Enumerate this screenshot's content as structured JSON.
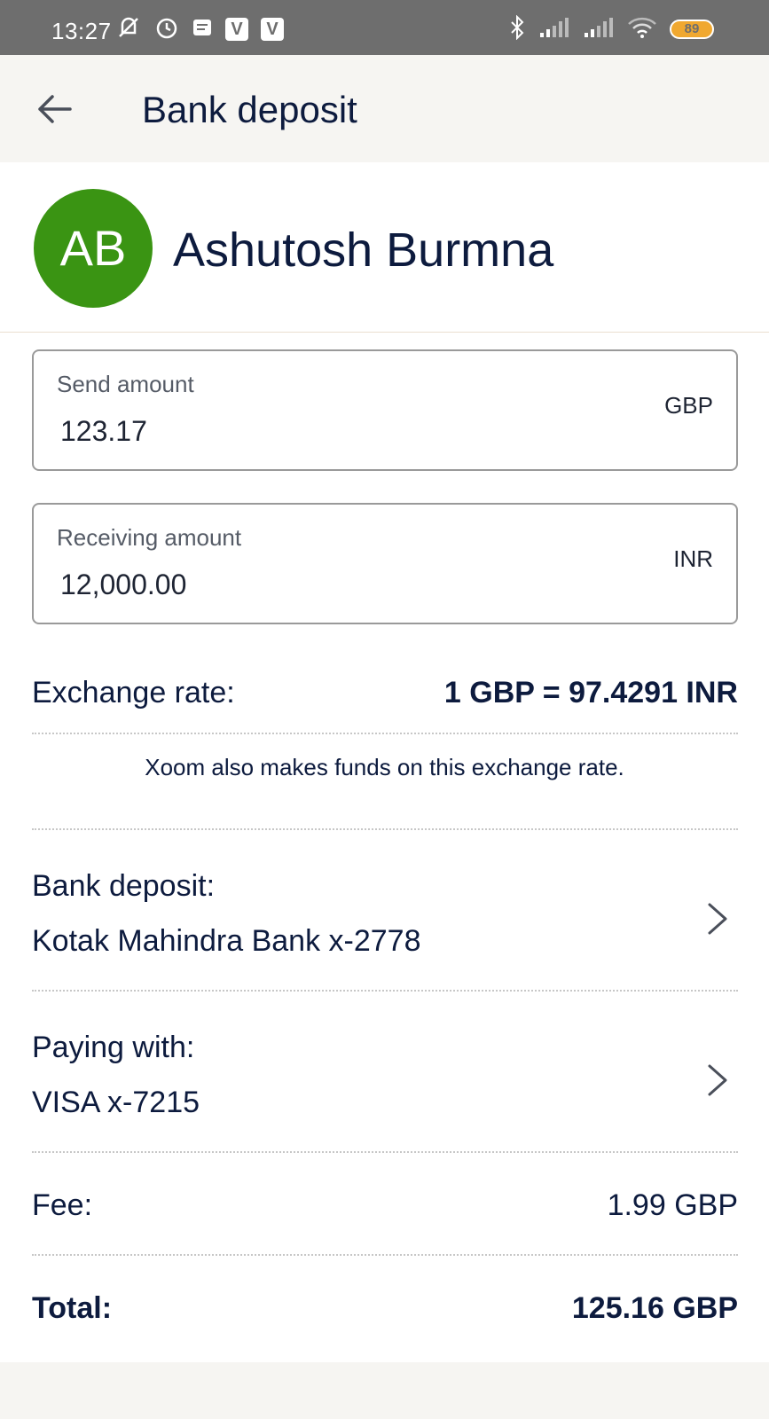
{
  "status_bar": {
    "time": "13:27",
    "battery": "89"
  },
  "header": {
    "title": "Bank deposit"
  },
  "recipient": {
    "initials": "AB",
    "name": "Ashutosh Burmna",
    "avatar_color": "#3a9413"
  },
  "send": {
    "label": "Send amount",
    "value": "123.17",
    "currency": "GBP"
  },
  "receive": {
    "label": "Receiving amount",
    "value": "12,000.00",
    "currency": "INR"
  },
  "exchange": {
    "label": "Exchange rate:",
    "value": "1 GBP = 97.4291 INR",
    "notice": "Xoom also makes funds on this exchange rate."
  },
  "bank_deposit": {
    "label": "Bank deposit:",
    "value": "Kotak Mahindra Bank x-2778"
  },
  "paying_with": {
    "label": "Paying with:",
    "value": "VISA x-7215"
  },
  "fee": {
    "label": "Fee:",
    "value": "1.99 GBP"
  },
  "total": {
    "label": "Total:",
    "value": "125.16 GBP"
  }
}
